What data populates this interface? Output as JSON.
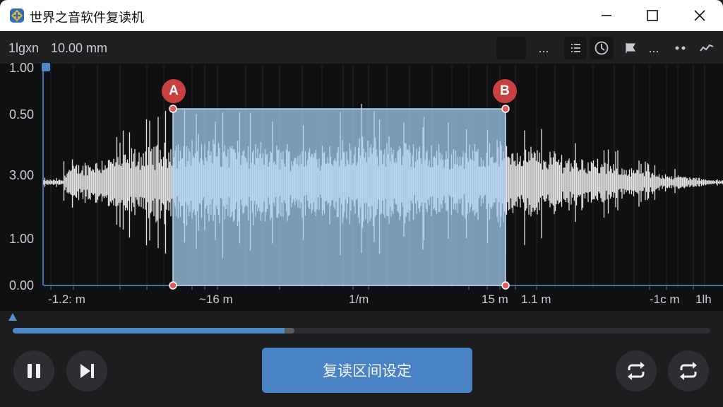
{
  "window": {
    "title": "世界之音软件复读机"
  },
  "toolbar": {
    "label": "1lgxn",
    "value": "10.00 mm",
    "more_label": "..."
  },
  "y_axis": {
    "ticks": [
      "1.00",
      "0.50",
      "3.00",
      "1.00",
      "0.00"
    ]
  },
  "x_axis": {
    "ticks": [
      "-1.2: m",
      "~16 m",
      "1/m",
      "15 m",
      "1.1 m",
      "-1c m",
      "1lh"
    ]
  },
  "markers": {
    "a": "A",
    "b": "B"
  },
  "playback": {
    "progress_percent": 39.4
  },
  "controls": {
    "set_loop_label": "复读区间设定"
  },
  "icons": {
    "app": "app-logo-icon",
    "minimize": "minimize-icon",
    "maximize": "maximize-icon",
    "close": "close-icon",
    "pause": "pause-icon",
    "next": "skip-next-icon",
    "repeat": "repeat-icon",
    "list": "list-icon",
    "clock": "clock-icon",
    "flag": "flag-icon",
    "wave": "wave-icon"
  },
  "colors": {
    "accent": "#4a82c6",
    "selection": "#a8d0f4",
    "marker": "#c94040",
    "waveform": "#e6e6e8"
  }
}
